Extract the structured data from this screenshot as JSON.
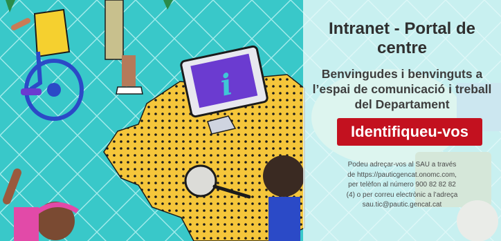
{
  "portal": {
    "title": "Intranet - Portal de centre",
    "welcome": "Benvingudes i benvinguts a l’espai de comunicació i treball del Departament",
    "login_label": "Identifiqueu-vos",
    "help_text_1": "Podeu adreçar-vos al SAU a través de",
    "help_link": "https://pauticgencat.onomc.com",
    "help_text_2": ", per telèfon al número 900 82 82 82 (4) o per correu electrònic a l’adreça sau.tic@pautic.gencat.cat"
  },
  "colors": {
    "button": "#c3111f",
    "background": "#39c8c9",
    "info_tablet": "#6b3bd0",
    "map_yellow": "#f5c63b"
  },
  "icons": {
    "hero_info": "info-icon"
  }
}
